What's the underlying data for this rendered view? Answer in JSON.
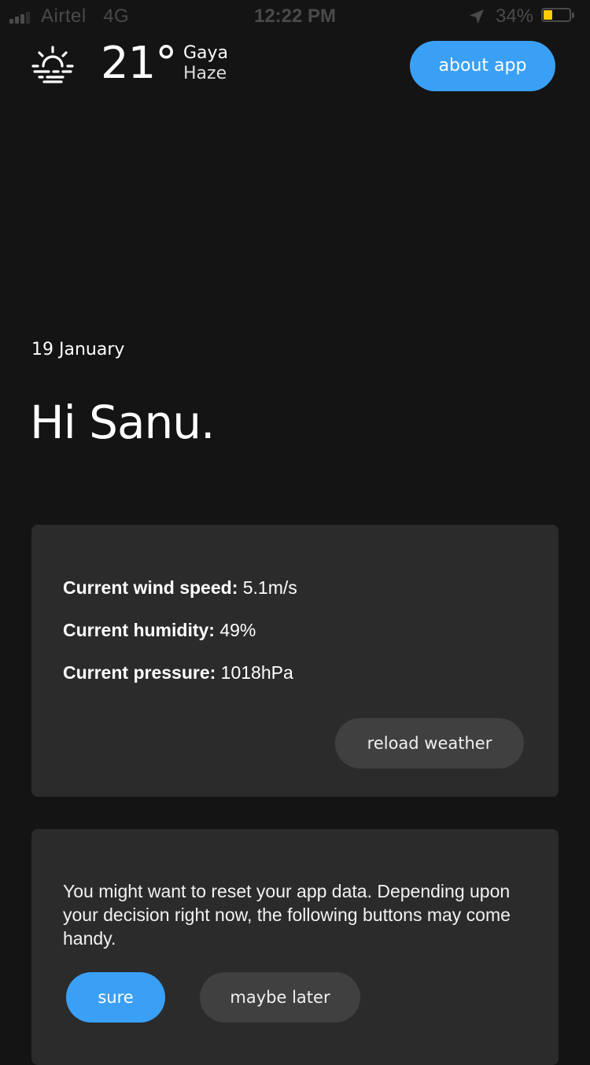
{
  "status_bar": {
    "carrier": "Airtel",
    "network": "4G",
    "time": "12:22 PM",
    "battery_percent": "34%",
    "battery_level": 0.34,
    "signal_bars": 3,
    "icons": [
      "signal-icon",
      "location-arrow-icon",
      "battery-icon"
    ],
    "battery_color": "#ffcc00"
  },
  "header": {
    "weather_icon": "haze-sun-icon",
    "temperature": "21°",
    "city": "Gaya",
    "condition": "Haze",
    "about_button": "about app"
  },
  "greeting": {
    "date": "19 January",
    "message": "Hi Sanu."
  },
  "weather_card": {
    "wind_label": "Current wind speed:",
    "wind_value": "5.1m/s",
    "humidity_label": "Current humidity:",
    "humidity_value": "49%",
    "pressure_label": "Current pressure:",
    "pressure_value": "1018hPa",
    "reload_button": "reload weather"
  },
  "reset_card": {
    "message": "You might want to reset your app data. Depending upon your decision right now, the following buttons may come handy.",
    "sure_button": "sure",
    "later_button": "maybe later"
  },
  "colors": {
    "background": "#141414",
    "card": "#2b2b2b",
    "accent": "#3aa0f5",
    "secondary_button": "#404040"
  }
}
